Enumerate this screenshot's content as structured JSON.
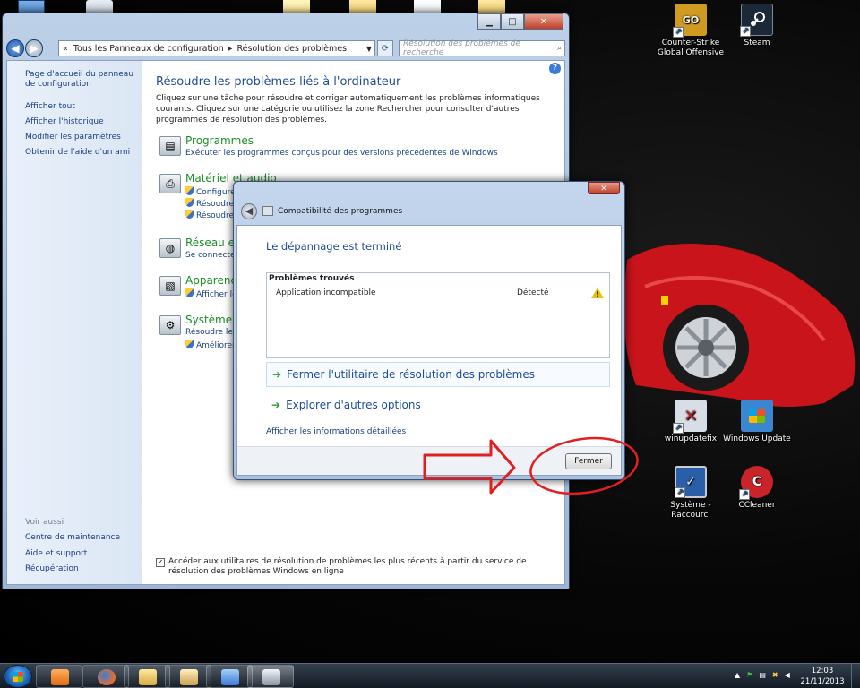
{
  "desktop": {
    "icons": [
      {
        "label": "Counter-Strike Global Offensive",
        "icon": "csgo-icon",
        "badge": "GO",
        "color": "#d09a22"
      },
      {
        "label": "Steam",
        "icon": "steam-icon",
        "badge": "",
        "color": "#1b2838"
      },
      {
        "label": "winupdatefix",
        "icon": "winupdatefix-icon",
        "badge": "",
        "color": "#d8dee6"
      },
      {
        "label": "Windows Update",
        "icon": "windows-update-icon",
        "badge": "",
        "color": "#3a86d0"
      },
      {
        "label": "Système - Raccourci",
        "icon": "system-shortcut-icon",
        "badge": "",
        "color": "#2a5ea8"
      },
      {
        "label": "CCleaner",
        "icon": "ccleaner-icon",
        "badge": "",
        "color": "#c8242a"
      }
    ]
  },
  "control_panel": {
    "window_controls": {
      "minimize": "▁",
      "maximize": "□",
      "close": "✕"
    },
    "address": {
      "prefix": "«",
      "crumb1": "Tous les Panneaux de configuration",
      "crumb2": "Résolution des problèmes"
    },
    "search_placeholder": "Résolution des problèmes de recherche",
    "sidebar": {
      "links": [
        "Page d'accueil du panneau de configuration",
        "Afficher tout",
        "Afficher l'historique",
        "Modifier les paramètres",
        "Obtenir de l'aide d'un ami"
      ],
      "see_also_title": "Voir aussi",
      "see_also": [
        "Centre de maintenance",
        "Aide et support",
        "Récupération"
      ]
    },
    "title": "Résoudre les problèmes liés à l'ordinateur",
    "description": "Cliquez sur une tâche pour résoudre et corriger automatiquement les problèmes informatiques courants. Cliquez sur une catégorie ou utilisez la zone Rechercher pour consulter d'autres programmes de résolution des problèmes.",
    "categories": [
      {
        "name": "Programmes",
        "links": [
          "Exécuter les programmes conçus pour des versions précédentes de Windows"
        ]
      },
      {
        "name": "Matériel et audio",
        "links": [
          "Configurer",
          "Résoudre",
          "Résoudre"
        ]
      },
      {
        "name": "Réseau et I",
        "links": [
          "Se connecter"
        ]
      },
      {
        "name": "Apparence",
        "links": [
          "Afficher les"
        ]
      },
      {
        "name": "Système et",
        "links": [
          "Résoudre les",
          "Améliorer"
        ]
      }
    ],
    "online_checkbox": "Accéder aux utilitaires de résolution de problèmes les plus récents à partir du service de résolution des problèmes Windows en ligne",
    "online_checked": true
  },
  "dialog": {
    "title": "Compatibilité des programmes",
    "close_glyph": "✕",
    "heading": "Le dépannage est terminé",
    "problems": {
      "header": "Problèmes trouvés",
      "rows": [
        {
          "name": "Application incompatible",
          "status": "Détecté"
        }
      ]
    },
    "options": [
      "Fermer l'utilitaire de résolution des problèmes",
      "Explorer d'autres options"
    ],
    "details_link": "Afficher les informations détaillées",
    "close_button": "Fermer"
  },
  "taskbar": {
    "pinned": [
      "media-player-icon",
      "firefox-icon",
      "explorer-icon",
      "folder-icon",
      "control-panel-icon",
      "troubleshooter-icon"
    ],
    "time": "12:03",
    "date": "21/11/2013"
  },
  "colors": {
    "link_blue": "#1b3f82",
    "category_green": "#1d8e2a",
    "heading_blue": "#1e4c9a",
    "annotation_red": "#e02020"
  }
}
